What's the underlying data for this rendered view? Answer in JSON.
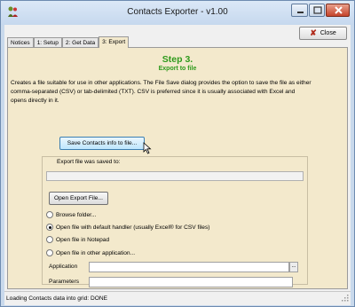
{
  "window": {
    "title": "Contacts Exporter - v1.00"
  },
  "toolbar": {
    "close_label": "Close"
  },
  "tabs": [
    {
      "label": "Notices"
    },
    {
      "label": "1: Setup"
    },
    {
      "label": "2: Get Data"
    },
    {
      "label": "3: Export"
    }
  ],
  "step": {
    "title": "Step 3.",
    "subtitle": "Export to file",
    "description": "Creates a file suitable for use in other applications. The File Save dialog provides the option to save the file as either comma-separated (CSV) or tab-delimited (TXT). CSV is preferred since it is usually associated with Excel and opens directly in it."
  },
  "save_button": {
    "label": "Save Contacts info to file..."
  },
  "export": {
    "saved_label": "Export file was saved to:",
    "saved_value": "",
    "open_button": "Open Export File..."
  },
  "options": [
    {
      "label": "Browse folder...",
      "checked": false
    },
    {
      "label": "Open file with default handler (usually Excel® for CSV files)",
      "checked": true
    },
    {
      "label": "Open file in Notepad",
      "checked": false
    },
    {
      "label": "Open file in other application...",
      "checked": false
    }
  ],
  "fields": {
    "application_label": "Application",
    "application_value": "",
    "browse_label": "...",
    "parameters_label": "Parameters",
    "parameters_value": ""
  },
  "status": {
    "text": "Loading Contacts data into grid: DONE"
  },
  "colors": {
    "step_green": "#2e9a1c",
    "panel_bg": "#f3e9cc"
  }
}
